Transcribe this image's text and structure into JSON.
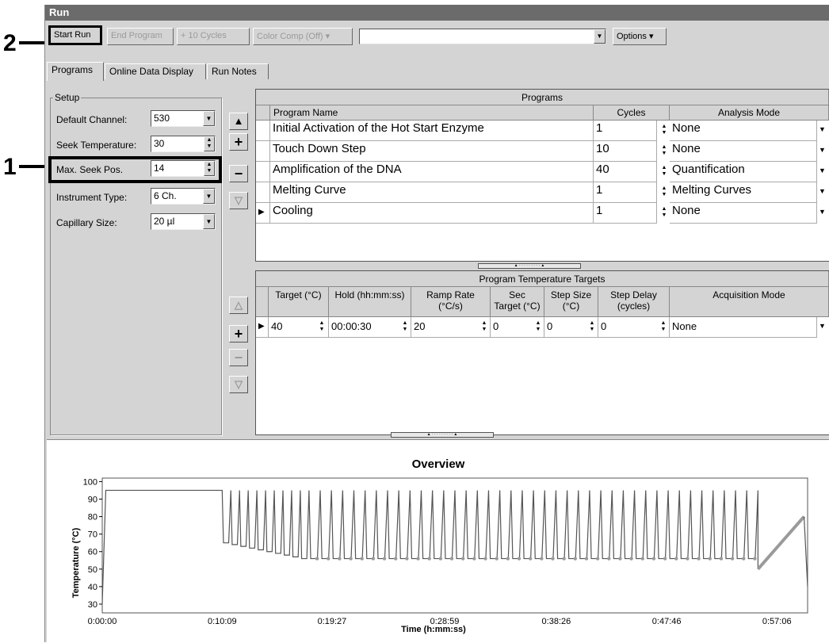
{
  "callouts": {
    "one": "1",
    "two": "2"
  },
  "window": {
    "title": "Run"
  },
  "toolbar": {
    "start_run": "Start Run",
    "end_program": "End Program",
    "plus_cycles": "+ 10 Cycles",
    "color_comp": "Color Comp (Off)",
    "program_select_value": "",
    "options": "Options"
  },
  "tabs": [
    "Programs",
    "Online Data Display",
    "Run Notes"
  ],
  "setup": {
    "title": "Setup",
    "fields": [
      {
        "label": "Default Channel:",
        "value": "530",
        "control": "dropdown"
      },
      {
        "label": "Seek Temperature:",
        "value": "30",
        "control": "spinner"
      },
      {
        "label": "Max. Seek Pos.",
        "value": "14",
        "control": "spinner"
      },
      {
        "label": "Instrument Type:",
        "value": "6 Ch.",
        "control": "dropdown"
      },
      {
        "label": "Capillary Size:",
        "value": "20 µl",
        "control": "dropdown"
      }
    ]
  },
  "programs": {
    "title": "Programs",
    "headers": [
      "Program Name",
      "Cycles",
      "Analysis Mode"
    ],
    "rows": [
      {
        "name": "Initial Activation of the Hot Start Enzyme",
        "cycles": "1",
        "mode": "None"
      },
      {
        "name": "Touch Down Step",
        "cycles": "10",
        "mode": "None"
      },
      {
        "name": "Amplification of the DNA",
        "cycles": "40",
        "mode": "Quantification"
      },
      {
        "name": "Melting Curve",
        "cycles": "1",
        "mode": "Melting Curves"
      },
      {
        "name": "Cooling",
        "cycles": "1",
        "mode": "None"
      }
    ]
  },
  "targets": {
    "title": "Program Temperature Targets",
    "headers": [
      "Target (°C)",
      "Hold (hh:mm:ss)",
      "Ramp Rate\n(°C/s)",
      "Sec\nTarget (°C)",
      "Step Size\n(°C)",
      "Step Delay\n(cycles)",
      "Acquisition Mode"
    ],
    "rows": [
      {
        "target": "40",
        "hold": "00:00:30",
        "ramp": "20",
        "sec_target": "0",
        "step_size": "0",
        "step_delay": "0",
        "acq": "None"
      }
    ]
  },
  "overview": {
    "title": "Overview",
    "ylabel": "Temperature (°C)",
    "xlabel": "Time (h:mm:ss)",
    "yticks": [
      "100",
      "90",
      "80",
      "70",
      "60",
      "50",
      "40",
      "30"
    ],
    "xticks": [
      "0:00:00",
      "0:10:09",
      "0:19:27",
      "0:28:59",
      "0:38:26",
      "0:47:46",
      "0:57:06"
    ]
  },
  "chart_data": {
    "type": "line",
    "title": "Overview",
    "xlabel": "Time (h:mm:ss)",
    "ylabel": "Temperature (°C)",
    "ylim": [
      25,
      102
    ],
    "x_tick_labels": [
      "0:00:00",
      "0:10:09",
      "0:19:27",
      "0:28:59",
      "0:38:26",
      "0:47:46",
      "0:57:06"
    ],
    "segments": [
      {
        "name": "Initial Activation",
        "points_min": [
          [
            0.0,
            30
          ],
          [
            0.3,
            95
          ],
          [
            10.15,
            95
          ]
        ]
      },
      {
        "name": "Touch Down",
        "cycles": 10,
        "high": 95,
        "low_start": 65,
        "low_end": 56,
        "t_start": 10.15,
        "t_end": 17.5
      },
      {
        "name": "Amplification",
        "cycles": 40,
        "high": 95,
        "low": 56,
        "t_start": 17.5,
        "t_end": 55.5
      },
      {
        "name": "Melting Curve",
        "points_min": [
          [
            55.5,
            50
          ],
          [
            59.4,
            80
          ]
        ]
      },
      {
        "name": "Cooling",
        "points_min": [
          [
            59.4,
            80
          ],
          [
            59.7,
            40
          ]
        ]
      }
    ],
    "grid": false
  }
}
